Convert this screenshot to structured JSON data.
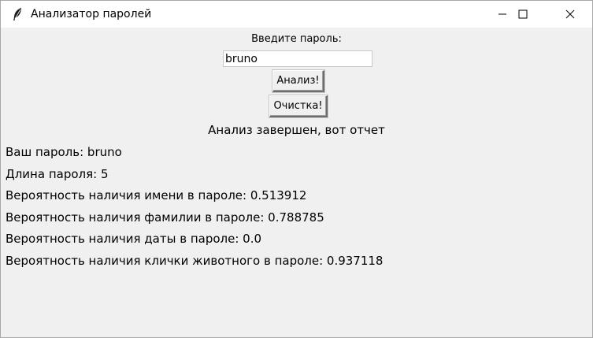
{
  "window": {
    "title": "Анализатор паролей"
  },
  "form": {
    "prompt_label": "Введите пароль:",
    "password_value": "bruno",
    "analyze_button": "Анализ!",
    "clear_button": "Очистка!"
  },
  "status": "Анализ завершен, вот отчет",
  "report": {
    "password_line": "Ваш пароль: bruno",
    "length_line": "Длина пароля: 5",
    "name_prob_line": "Вероятность наличия имени в пароле: 0.513912",
    "surname_prob_line": "Вероятность наличия фамилии в пароле: 0.788785",
    "date_prob_line": "Вероятность наличия даты в пароле: 0.0",
    "pet_prob_line": "Вероятность наличия клички животного в пароле: 0.937118"
  },
  "icons": {
    "app": "feather-icon",
    "minimize": "minimize-icon",
    "maximize": "maximize-icon",
    "close": "close-icon"
  }
}
